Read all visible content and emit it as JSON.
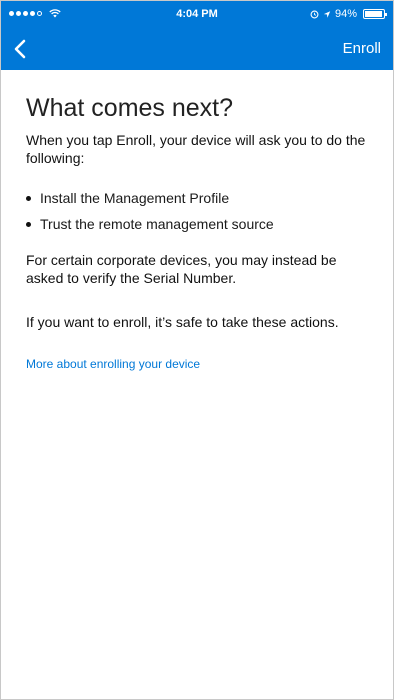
{
  "status_bar": {
    "time": "4:04 PM",
    "battery_percent": "94%",
    "battery_level": 0.94,
    "signal_icon": "signal-dots-icon",
    "wifi_icon": "wifi-icon",
    "location_icon": "location-arrow-icon",
    "alarm_icon": "alarm-icon"
  },
  "nav": {
    "back_icon": "chevron-left-icon",
    "enroll_label": "Enroll"
  },
  "main": {
    "title": "What comes next?",
    "intro": "When you tap Enroll, your device will ask you to do the following:",
    "bullets": [
      "Install the Management Profile",
      "Trust the remote management source"
    ],
    "paragraph_1": "For certain corporate devices, you may instead be asked to verify the Serial Number.",
    "paragraph_2": "If you want to enroll, it’s safe to take these actions.",
    "link_text": "More about enrolling your device"
  },
  "colors": {
    "accent": "#0078d7",
    "background": "#ffffff",
    "text": "#111111"
  }
}
